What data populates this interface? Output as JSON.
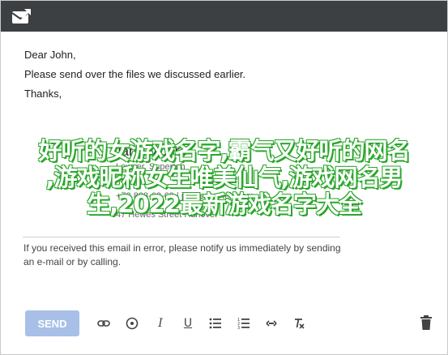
{
  "message": {
    "greeting": "Dear John,",
    "line1": "Please send over the files we discussed earlier.",
    "closing": "Thanks,"
  },
  "signature": {
    "name": "Jane Moore",
    "title": "Lawyer, Superteh",
    "phone": "+78 888-68-68 | jm@superteh.com",
    "address": "47 Hewes Street Hanover"
  },
  "disclaimer": "If you received this email in error, please notify us immediately by sending an e-mail or by calling.",
  "overlay": {
    "line1": "好听的女游戏名字,霸气又好听的网名",
    "line2": ",游戏昵称女生唯美仙气,游戏网名男",
    "line3": "生,2022最新游戏名字大全"
  },
  "toolbar": {
    "send_label": "SEND",
    "icons": [
      "link-icon",
      "image-icon",
      "italic-icon",
      "underline-icon",
      "bullet-list-icon",
      "numbered-list-icon",
      "code-icon",
      "clear-format-icon",
      "trash-icon"
    ]
  },
  "colors": {
    "titlebar": "#3c4043",
    "send_button": "#a8c0e8",
    "overlay_shadow": "#2aa62a"
  }
}
